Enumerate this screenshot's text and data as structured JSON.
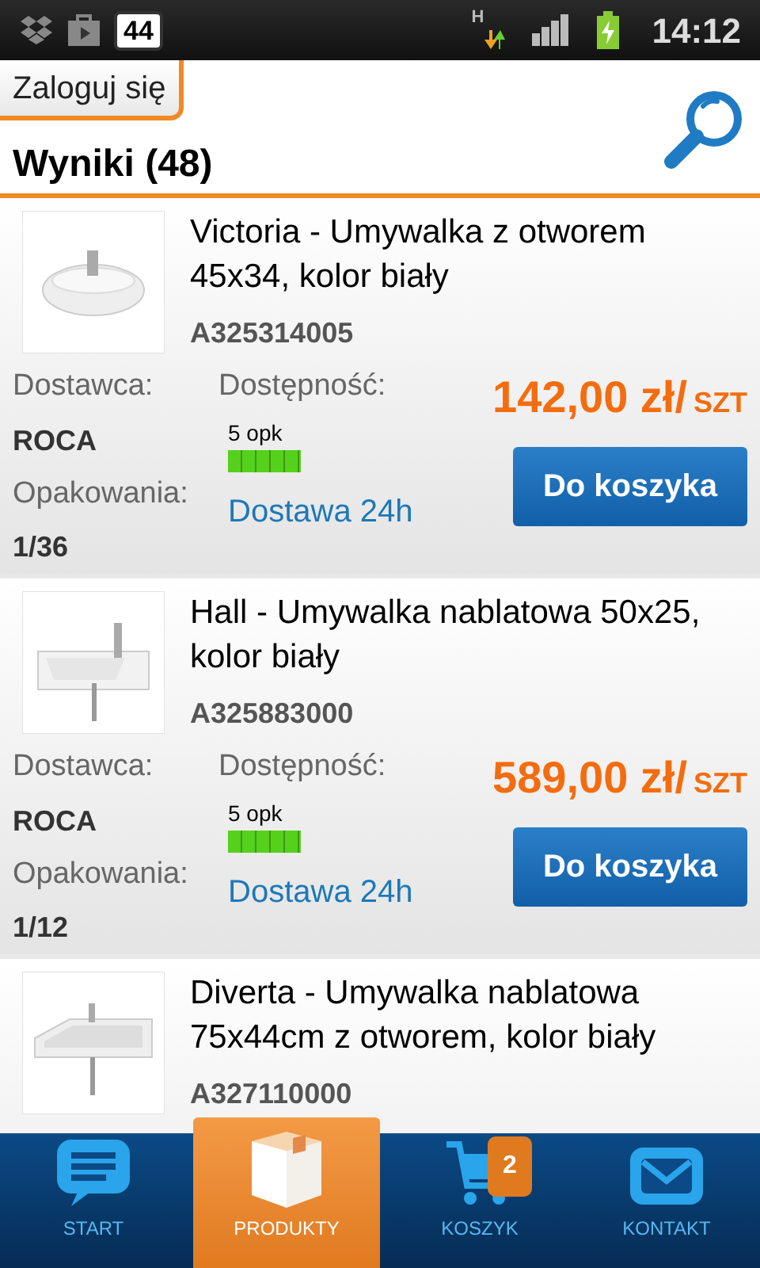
{
  "status_bar": {
    "notification_count": "44",
    "network": "H",
    "time": "14:12"
  },
  "header": {
    "login_label": "Zaloguj się",
    "title": "Wyniki (48)"
  },
  "products": [
    {
      "name": "Victoria - Umywalka z otworem 45x34, kolor biały",
      "code": "A325314005",
      "supplier_label": "Dostawca:",
      "supplier": "ROCA",
      "packaging_label": "Opakowania:",
      "packaging": "1/36",
      "availability_label": "Dostępność:",
      "availability": {
        "label": "5 opk",
        "level": 1
      },
      "delivery": "Dostawa 24h",
      "price": "142,00 zł/",
      "unit": "SZT",
      "button": "Do koszyka"
    },
    {
      "name": "Hall - Umywalka nablatowa 50x25, kolor biały",
      "code": "A325883000",
      "supplier_label": "Dostawca:",
      "supplier": "ROCA",
      "packaging_label": "Opakowania:",
      "packaging": "1/12",
      "availability_label": "Dostępność:",
      "availability": {
        "label": "5 opk",
        "level": 1
      },
      "delivery": "Dostawa 24h",
      "price": "589,00 zł/",
      "unit": "SZT",
      "button": "Do koszyka"
    },
    {
      "name": "Diverta - Umywalka nablatowa 75x44cm z otworem, kolor biały",
      "code": "A327110000"
    }
  ],
  "nav": [
    {
      "kind": "start",
      "label": "START",
      "selected": false
    },
    {
      "kind": "products",
      "label": "PRODUKTY",
      "selected": true
    },
    {
      "kind": "cart",
      "label": "KOSZYK",
      "selected": false,
      "badge": "2"
    },
    {
      "kind": "contact",
      "label": "KONTAKT",
      "selected": false
    }
  ]
}
